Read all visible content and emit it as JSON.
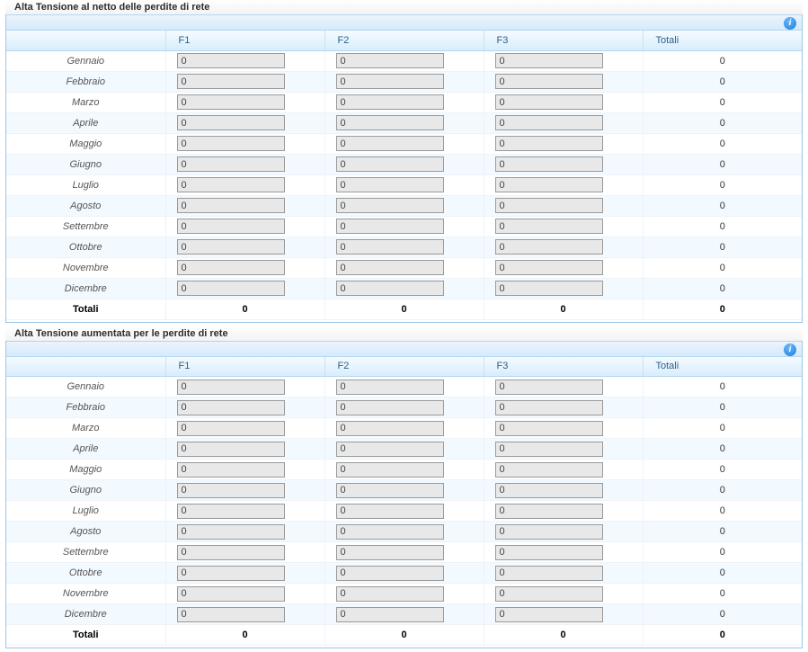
{
  "months": [
    "Gennaio",
    "Febbraio",
    "Marzo",
    "Aprile",
    "Maggio",
    "Giugno",
    "Luglio",
    "Agosto",
    "Settembre",
    "Ottobre",
    "Novembre",
    "Dicembre"
  ],
  "columns": {
    "c0": "",
    "c1": "F1",
    "c2": "F2",
    "c3": "F3",
    "c4": "Totali"
  },
  "totalsLabel": "Totali",
  "panels": [
    {
      "title": "Alta Tensione al netto delle perdite di rete",
      "rows": [
        {
          "f1": "0",
          "f2": "0",
          "f3": "0",
          "tot": "0"
        },
        {
          "f1": "0",
          "f2": "0",
          "f3": "0",
          "tot": "0"
        },
        {
          "f1": "0",
          "f2": "0",
          "f3": "0",
          "tot": "0"
        },
        {
          "f1": "0",
          "f2": "0",
          "f3": "0",
          "tot": "0"
        },
        {
          "f1": "0",
          "f2": "0",
          "f3": "0",
          "tot": "0"
        },
        {
          "f1": "0",
          "f2": "0",
          "f3": "0",
          "tot": "0"
        },
        {
          "f1": "0",
          "f2": "0",
          "f3": "0",
          "tot": "0"
        },
        {
          "f1": "0",
          "f2": "0",
          "f3": "0",
          "tot": "0"
        },
        {
          "f1": "0",
          "f2": "0",
          "f3": "0",
          "tot": "0"
        },
        {
          "f1": "0",
          "f2": "0",
          "f3": "0",
          "tot": "0"
        },
        {
          "f1": "0",
          "f2": "0",
          "f3": "0",
          "tot": "0"
        },
        {
          "f1": "0",
          "f2": "0",
          "f3": "0",
          "tot": "0"
        }
      ],
      "totals": {
        "f1": "0",
        "f2": "0",
        "f3": "0",
        "tot": "0"
      }
    },
    {
      "title": "Alta Tensione aumentata per le perdite di rete",
      "rows": [
        {
          "f1": "0",
          "f2": "0",
          "f3": "0",
          "tot": "0"
        },
        {
          "f1": "0",
          "f2": "0",
          "f3": "0",
          "tot": "0"
        },
        {
          "f1": "0",
          "f2": "0",
          "f3": "0",
          "tot": "0"
        },
        {
          "f1": "0",
          "f2": "0",
          "f3": "0",
          "tot": "0"
        },
        {
          "f1": "0",
          "f2": "0",
          "f3": "0",
          "tot": "0"
        },
        {
          "f1": "0",
          "f2": "0",
          "f3": "0",
          "tot": "0"
        },
        {
          "f1": "0",
          "f2": "0",
          "f3": "0",
          "tot": "0"
        },
        {
          "f1": "0",
          "f2": "0",
          "f3": "0",
          "tot": "0"
        },
        {
          "f1": "0",
          "f2": "0",
          "f3": "0",
          "tot": "0"
        },
        {
          "f1": "0",
          "f2": "0",
          "f3": "0",
          "tot": "0"
        },
        {
          "f1": "0",
          "f2": "0",
          "f3": "0",
          "tot": "0"
        },
        {
          "f1": "0",
          "f2": "0",
          "f3": "0",
          "tot": "0"
        }
      ],
      "totals": {
        "f1": "0",
        "f2": "0",
        "f3": "0",
        "tot": "0"
      }
    }
  ]
}
